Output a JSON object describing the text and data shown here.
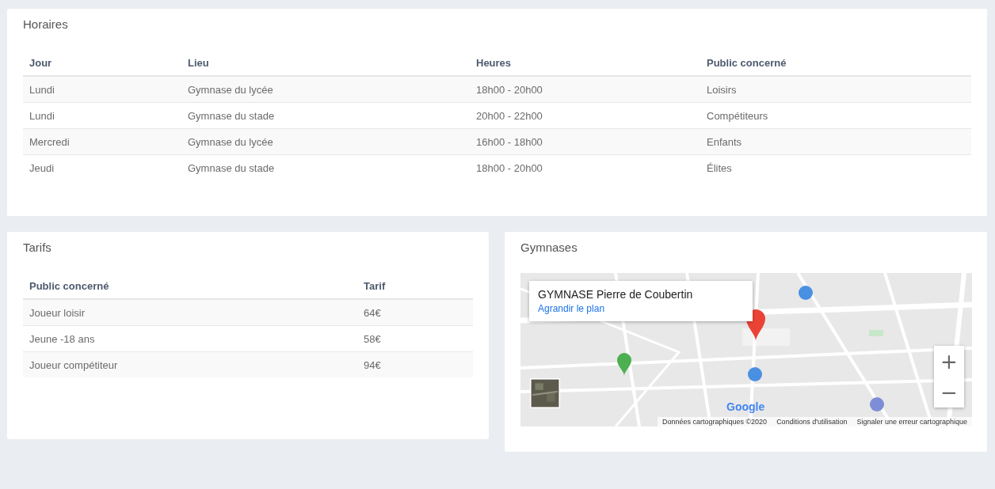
{
  "horaires": {
    "title": "Horaires",
    "columns": [
      "Jour",
      "Lieu",
      "Heures",
      "Public concerné"
    ],
    "rows": [
      [
        "Lundi",
        "Gymnase du lycée",
        "18h00 - 20h00",
        "Loisirs"
      ],
      [
        "Lundi",
        "Gymnase du stade",
        "20h00 - 22h00",
        "Compétiteurs"
      ],
      [
        "Mercredi",
        "Gymnase du lycée",
        "16h00 - 18h00",
        "Enfants"
      ],
      [
        "Jeudi",
        "Gymnase du stade",
        "18h00 - 20h00",
        "Élites"
      ]
    ]
  },
  "tarifs": {
    "title": "Tarifs",
    "columns": [
      "Public concerné",
      "Tarif"
    ],
    "rows": [
      [
        "Joueur loisir",
        "64€"
      ],
      [
        "Jeune -18 ans",
        "58€"
      ],
      [
        "Joueur compétiteur",
        "94€"
      ]
    ]
  },
  "gymnases": {
    "title": "Gymnases",
    "map": {
      "kind": "picture",
      "place_title": "GYMNASE Pierre de Coubertin",
      "place_link": "Agrandir le plan",
      "zoom_in": "+",
      "zoom_out": "−",
      "logo": "Google",
      "attribution": [
        "Données cartographiques ©2020",
        "Conditions d'utilisation",
        "Signaler une erreur cartographique"
      ]
    }
  }
}
